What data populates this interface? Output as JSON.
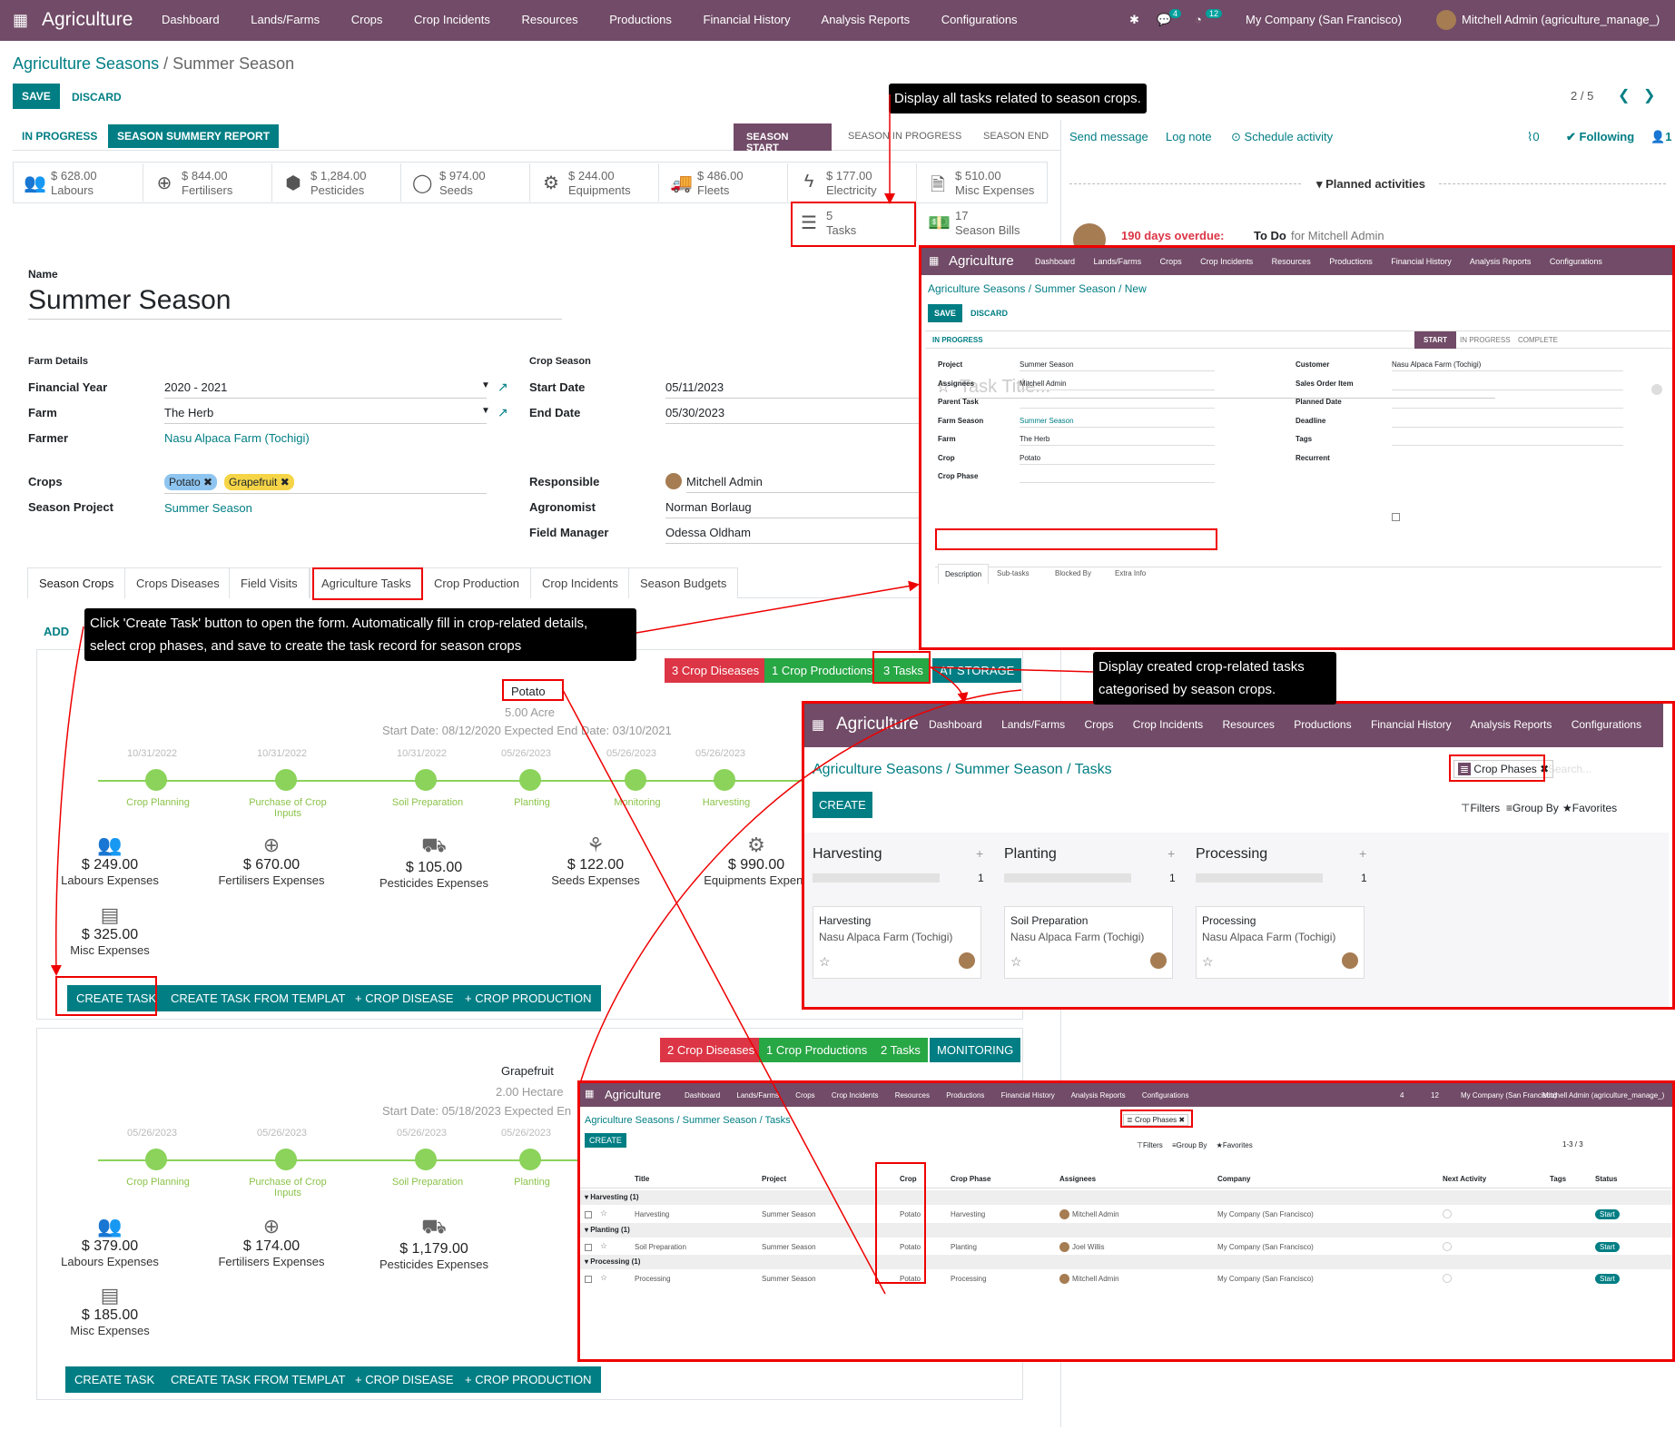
{
  "topbar": {
    "app": "Agriculture",
    "menu": [
      "Dashboard",
      "Lands/Farms",
      "Crops",
      "Crop Incidents",
      "Resources",
      "Productions",
      "Financial History",
      "Analysis Reports",
      "Configurations"
    ],
    "msg_count": "4",
    "activity_count": "12",
    "company": "My Company (San Francisco)",
    "user": "Mitchell Admin (agriculture_manage_)"
  },
  "breadcrumb": {
    "parent": "Agriculture Seasons",
    "current": "Summer Season"
  },
  "actions": {
    "save": "SAVE",
    "discard": "DISCARD",
    "pager": "2 / 5"
  },
  "statusbar": {
    "btn1": "IN PROGRESS",
    "btn2": "SEASON SUMMERY REPORT",
    "stages": [
      "SEASON START",
      "SEASON IN PROGRESS",
      "SEASON END"
    ]
  },
  "chatter": {
    "send": "Send message",
    "log": "Log note",
    "schedule": "Schedule activity",
    "att": "0",
    "following": "Following",
    "followers": "1",
    "planned": "Planned activities",
    "overdue": "190 days overdue:",
    "todo": "To Do",
    "for": "for Mitchell Admin"
  },
  "smart": [
    {
      "v": "$ 628.00",
      "l": "Labours"
    },
    {
      "v": "$ 844.00",
      "l": "Fertilisers"
    },
    {
      "v": "$ 1,284.00",
      "l": "Pesticides"
    },
    {
      "v": "$ 974.00",
      "l": "Seeds"
    },
    {
      "v": "$ 244.00",
      "l": "Equipments"
    },
    {
      "v": "$ 486.00",
      "l": "Fleets"
    },
    {
      "v": "$ 177.00",
      "l": "Electricity"
    },
    {
      "v": "$ 510.00",
      "l": "Misc Expenses"
    },
    {
      "v": "5",
      "l": "Tasks"
    },
    {
      "v": "17",
      "l": "Season Bills"
    }
  ],
  "form": {
    "name_label": "Name",
    "name": "Summer Season",
    "farm_details": "Farm Details",
    "fy_label": "Financial Year",
    "fy": "2020 - 2021",
    "farm_label": "Farm",
    "farm": "The Herb",
    "farmer_label": "Farmer",
    "farmer": "Nasu Alpaca Farm (Tochigi)",
    "crop_season": "Crop Season",
    "start_label": "Start Date",
    "start": "05/11/2023",
    "end_label": "End Date",
    "end": "05/30/2023",
    "crops_label": "Crops",
    "crop1": "Potato",
    "crop2": "Grapefruit",
    "proj_label": "Season Project",
    "proj": "Summer Season",
    "resp_label": "Responsible",
    "resp": "Mitchell Admin",
    "agro_label": "Agronomist",
    "agro": "Norman Borlaug",
    "fm_label": "Field Manager",
    "fm": "Odessa Oldham"
  },
  "tabs": [
    "Season Crops",
    "Crops Diseases",
    "Field Visits",
    "Agriculture Tasks",
    "Crop Production",
    "Crop Incidents",
    "Season Budgets"
  ],
  "add": "ADD",
  "callouts": {
    "c1": "Display all tasks related to season crops.",
    "c2a": "Click 'Create Task' button to open the form. Automatically fill in crop-related details,",
    "c2b": "select crop phases, and save to create the task record for season crops",
    "c3a": "Display created crop-related tasks",
    "c3b": "categorised by season crops."
  },
  "crop1": {
    "pills": [
      "3 Crop Diseases",
      "1 Crop Productions",
      "3 Tasks",
      "AT STORAGE"
    ],
    "name": "Potato",
    "area": "5.00  Acre",
    "dates": "Start Date: 08/12/2020    Expected End Date: 03/10/2021",
    "phase_dates": [
      "10/31/2022",
      "10/31/2022",
      "10/31/2022",
      "05/26/2023",
      "05/26/2023",
      "05/26/2023"
    ],
    "phases": [
      "Crop Planning",
      "Purchase of Crop Inputs",
      "Soil Preparation",
      "Planting",
      "Monitoring",
      "Harvesting"
    ],
    "exp": [
      {
        "a": "$ 249.00",
        "l": "Labours Expenses"
      },
      {
        "a": "$ 670.00",
        "l": "Fertilisers Expenses"
      },
      {
        "a": "$ 105.00",
        "l": "Pesticides Expenses"
      },
      {
        "a": "$ 122.00",
        "l": "Seeds Expenses"
      },
      {
        "a": "$ 990.00",
        "l": "Equipments Expens"
      },
      {
        "a": "$ 325.00",
        "l": "Misc Expenses"
      }
    ]
  },
  "crop2": {
    "pills": [
      "2 Crop Diseases",
      "1 Crop Productions",
      "2 Tasks",
      "MONITORING"
    ],
    "name": "Grapefruit",
    "area": "2.00  Hectare",
    "dates": "Start Date: 05/18/2023    Expected En",
    "phase_dates": [
      "05/26/2023",
      "05/26/2023",
      "05/26/2023",
      "05/26/2023"
    ],
    "phases": [
      "Crop Planning",
      "Purchase of Crop Inputs",
      "Soil Preparation",
      "Planting"
    ],
    "exp": [
      {
        "a": "$ 379.00",
        "l": "Labours Expenses"
      },
      {
        "a": "$ 174.00",
        "l": "Fertilisers Expenses"
      },
      {
        "a": "$ 1,179.00",
        "l": "Pesticides Expenses"
      },
      {
        "a": "$ 185.00",
        "l": "Misc Expenses"
      }
    ]
  },
  "task_buttons": [
    "CREATE TASK",
    "CREATE TASK FROM TEMPLATE",
    "+ CROP DISEASE",
    "+ CROP PRODUCTION"
  ],
  "ov1": {
    "bc": "Agriculture Seasons / Summer Season / New",
    "status": "IN PROGRESS",
    "stages": [
      "START",
      "IN PROGRESS",
      "COMPLETE"
    ],
    "title_ph": "Task Title...",
    "fields_l": [
      [
        "Project",
        "Summer Season"
      ],
      [
        "Assignees",
        "Mitchell Admin"
      ],
      [
        "Parent Task",
        ""
      ],
      [
        "Farm Season",
        "Summer Season"
      ],
      [
        "Farm",
        "The Herb"
      ],
      [
        "Crop",
        "Potato"
      ],
      [
        "Crop Phase",
        ""
      ]
    ],
    "fields_r": [
      [
        "Customer",
        "Nasu Alpaca Farm (Tochigi)"
      ],
      [
        "Sales Order Item",
        ""
      ],
      [
        "Planned Date",
        ""
      ],
      [
        "Deadline",
        ""
      ],
      [
        "Tags",
        ""
      ],
      [
        "Recurrent",
        ""
      ]
    ],
    "tabs": [
      "Description",
      "Sub-tasks",
      "Blocked By",
      "Extra Info"
    ]
  },
  "ov2": {
    "bc": "Agriculture Seasons / Summer Season / Tasks",
    "facet": "Crop Phases",
    "search": "Search...",
    "create": "CREATE",
    "filters": "Filters",
    "groupby": "Group By",
    "favorites": "Favorites",
    "cols": [
      {
        "t": "Harvesting",
        "c": "1",
        "card": "Harvesting"
      },
      {
        "t": "Planting",
        "c": "1",
        "card": "Soil Preparation"
      },
      {
        "t": "Processing",
        "c": "1",
        "card": "Processing"
      }
    ],
    "farm": "Nasu Alpaca Farm (Tochigi)"
  },
  "ov3": {
    "bc": "Agriculture Seasons / Summer Season / Tasks",
    "pager": "1-3 / 3",
    "headers": [
      "Title",
      "Project",
      "Crop",
      "Crop Phase",
      "Assignees",
      "Company",
      "Next Activity",
      "Tags",
      "Status"
    ],
    "groups": [
      {
        "g": "Harvesting (1)",
        "r": [
          "Harvesting",
          "Summer Season",
          "Potato",
          "Harvesting",
          "Mitchell Admin",
          "My Company (San Francisco)",
          "Start"
        ]
      },
      {
        "g": "Planting (1)",
        "r": [
          "Soil Preparation",
          "Summer Season",
          "Potato",
          "Planting",
          "Joel Willis",
          "My Company (San Francisco)",
          "Start"
        ]
      },
      {
        "g": "Processing (1)",
        "r": [
          "Processing",
          "Summer Season",
          "Potato",
          "Processing",
          "Mitchell Admin",
          "My Company (San Francisco)",
          "Start"
        ]
      }
    ]
  }
}
